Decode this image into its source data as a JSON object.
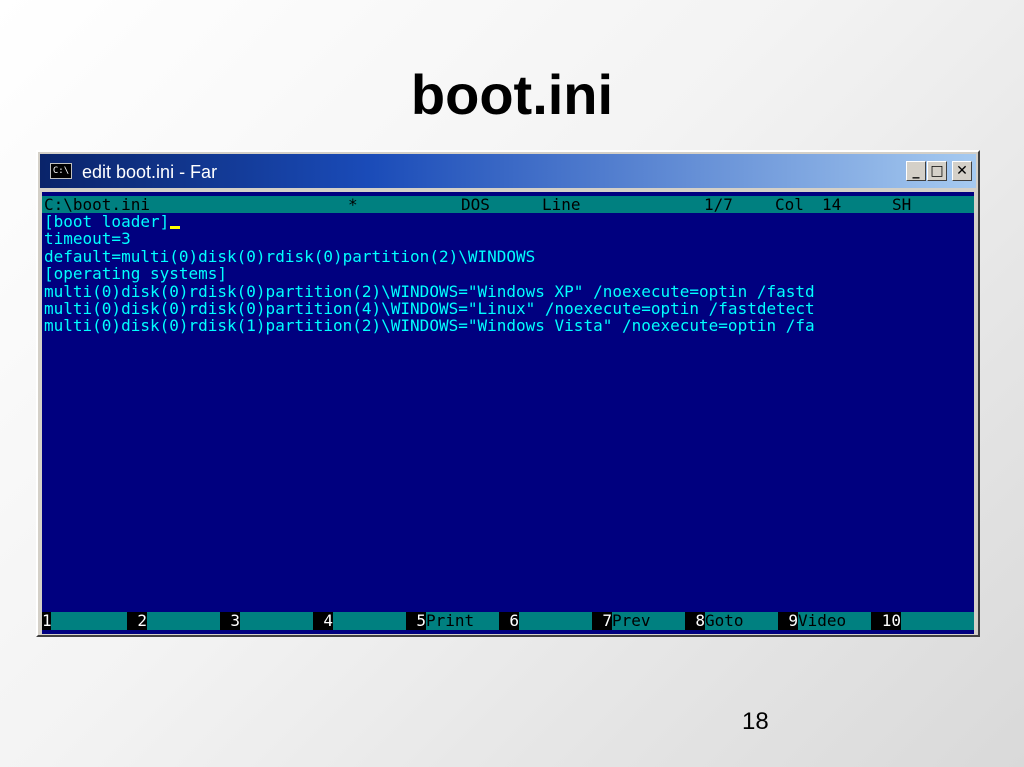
{
  "slide": {
    "title": "boot.ini",
    "page_number": "18"
  },
  "window": {
    "title": "edit boot.ini - Far",
    "sys_icon": "C:\\",
    "icons": [
      "console-icon",
      "minimize-icon",
      "maximize-icon",
      "close-icon"
    ]
  },
  "status": {
    "path": "C:\\boot.ini",
    "modified": "*",
    "encoding": "DOS",
    "line_label": "Line",
    "line_value": "1/7",
    "col_label": "Col",
    "col_value": "14",
    "extra": "SH"
  },
  "lines": [
    "[boot loader]",
    "timeout=3",
    "default=multi(0)disk(0)rdisk(0)partition(2)\\WINDOWS",
    "[operating systems]",
    "multi(0)disk(0)rdisk(0)partition(2)\\WINDOWS=\"Windows XP\" /noexecute=optin /fastd",
    "multi(0)disk(0)rdisk(0)partition(4)\\WINDOWS=\"Linux\" /noexecute=optin /fastdetect",
    "multi(0)disk(0)rdisk(1)partition(2)\\WINDOWS=\"Windows Vista\" /noexecute=optin /fa"
  ],
  "keybar": [
    {
      "num": "1",
      "label": ""
    },
    {
      "num": "2",
      "label": ""
    },
    {
      "num": "3",
      "label": ""
    },
    {
      "num": "4",
      "label": ""
    },
    {
      "num": "5",
      "label": "Print"
    },
    {
      "num": "6",
      "label": ""
    },
    {
      "num": "7",
      "label": "Prev"
    },
    {
      "num": "8",
      "label": "Goto"
    },
    {
      "num": "9",
      "label": "Video"
    },
    {
      "num": "10",
      "label": ""
    }
  ],
  "colors": {
    "console_bg": "#00007f",
    "text": "#00ffff",
    "status_bg": "#008080",
    "cursor": "#ffff00"
  }
}
